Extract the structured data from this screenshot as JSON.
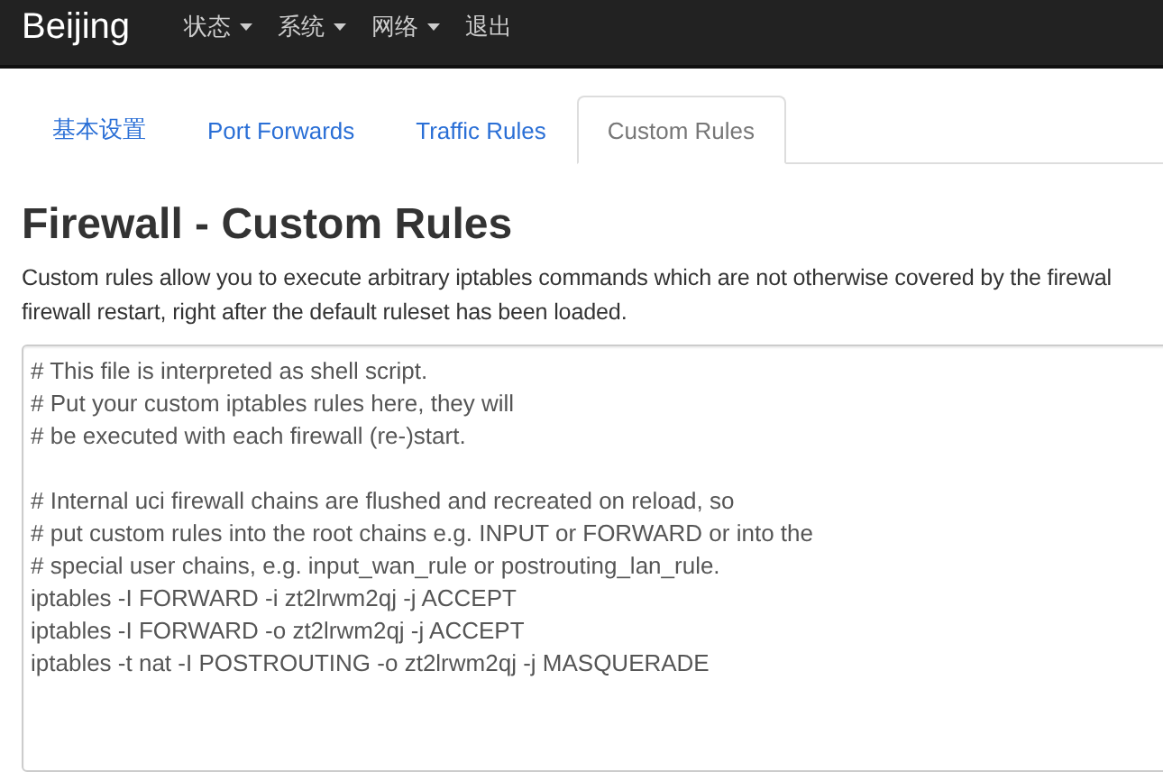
{
  "navbar": {
    "brand": "Beijing",
    "menu": [
      {
        "label": "状态",
        "dropdown": true
      },
      {
        "label": "系统",
        "dropdown": true
      },
      {
        "label": "网络",
        "dropdown": true
      },
      {
        "label": "退出",
        "dropdown": false
      }
    ]
  },
  "tabs": [
    {
      "label": "基本设置",
      "selected": false
    },
    {
      "label": "Port Forwards",
      "selected": false
    },
    {
      "label": "Traffic Rules",
      "selected": false
    },
    {
      "label": "Custom Rules",
      "selected": true
    }
  ],
  "title": "Firewall - Custom Rules",
  "description": [
    "Custom rules allow you to execute arbitrary iptables commands which are not otherwise covered by the firewal",
    "firewall restart, right after the default ruleset has been loaded."
  ],
  "editor": {
    "blocks": [
      [
        "# This file is interpreted as shell script.",
        "# Put your custom iptables rules here, they will",
        "# be executed with each firewall (re-)start."
      ],
      [
        "# Internal uci firewall chains are flushed and recreated on reload, so",
        "# put custom rules into the root chains e.g. INPUT or FORWARD or into the",
        "# special user chains, e.g. input_wan_rule or postrouting_lan_rule.",
        "iptables -I FORWARD -i zt2lrwm2qj -j ACCEPT",
        "iptables -I FORWARD -o zt2lrwm2qj -j ACCEPT",
        "iptables -t nat -I POSTROUTING -o zt2lrwm2qj -j MASQUERADE"
      ]
    ]
  }
}
